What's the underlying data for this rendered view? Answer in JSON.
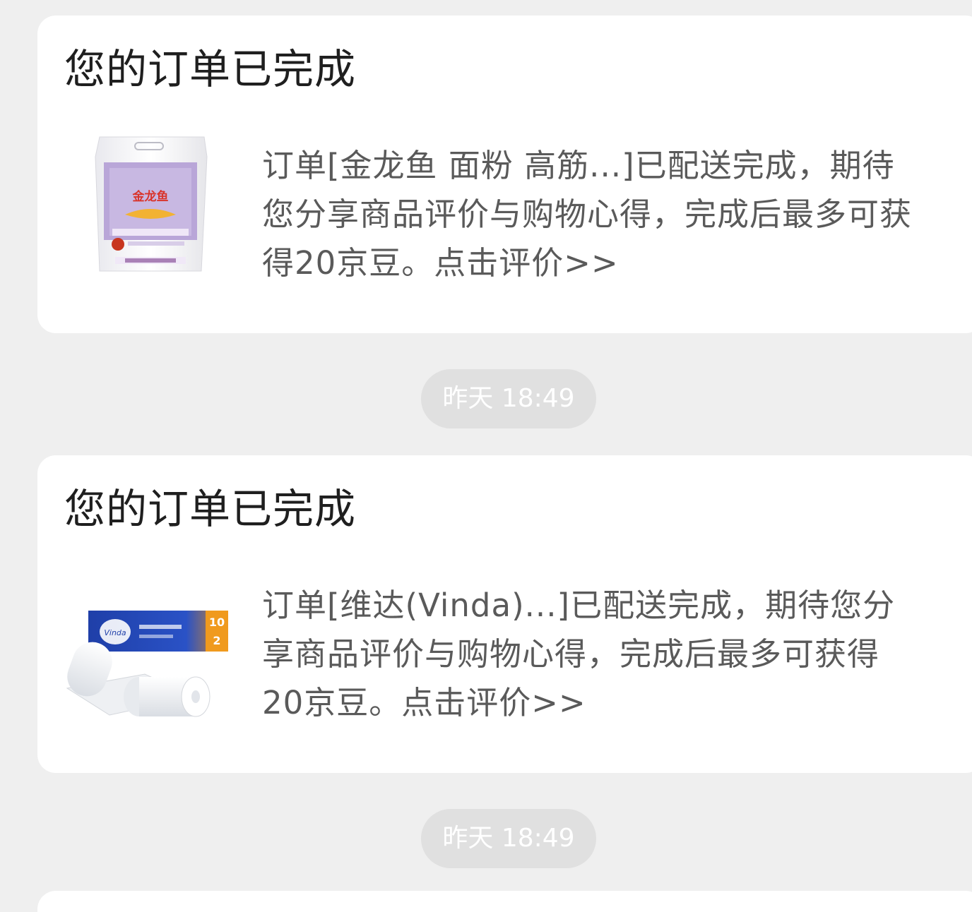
{
  "messages": [
    {
      "title": "您的订单已完成",
      "body": "订单[金龙鱼 面粉 高筋...]已配送完成，期待您分享商品评价与购物心得，完成后最多可获得20京豆。点击评价>>",
      "product_image": "flour-bag-image",
      "product_label": "金龙鱼"
    },
    {
      "title": "您的订单已完成",
      "body": "订单[维达(Vinda)...]已配送完成，期待您分享商品评价与购物心得，完成后最多可获得20京豆。点击评价>>",
      "product_image": "tissue-rolls-image",
      "product_label": "Vinda"
    }
  ],
  "timestamps": [
    "昨天 18:49",
    "昨天 18:49"
  ],
  "colors": {
    "background": "#efefef",
    "card": "#ffffff",
    "title": "#1f1f1f",
    "body": "#5a5a5a",
    "pill": "#e0e0e0"
  }
}
